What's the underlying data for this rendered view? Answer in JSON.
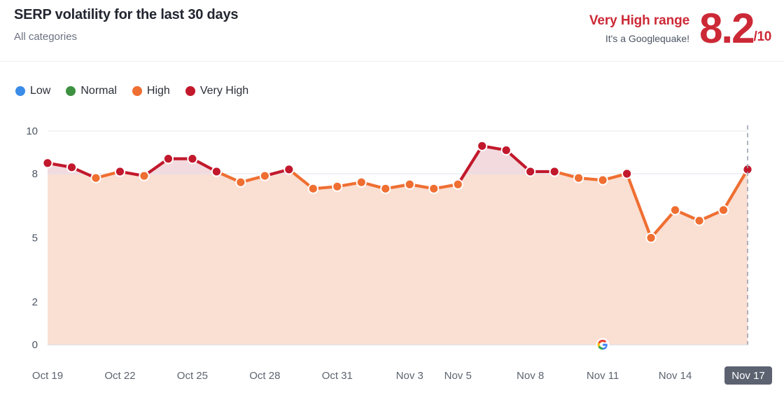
{
  "header": {
    "title": "SERP volatility for the last 30 days",
    "subtitle": "All categories",
    "range_label": "Very High range",
    "range_caption": "It's a Googlequake!",
    "score_value": "8.2",
    "score_denominator": "/10",
    "score_color": "#cc2936"
  },
  "legend": {
    "items": [
      {
        "label": "Low",
        "color": "#3b8ce8"
      },
      {
        "label": "Normal",
        "color": "#3d9140"
      },
      {
        "label": "High",
        "color": "#ef6f32"
      },
      {
        "label": "Very High",
        "color": "#c2182c"
      }
    ]
  },
  "chart_data": {
    "type": "line",
    "title": "SERP volatility for the last 30 days",
    "subtitle": "All categories",
    "xlabel": "",
    "ylabel": "",
    "ylim": [
      0,
      10
    ],
    "y_ticks": [
      "0",
      "2",
      "5",
      "8",
      "10"
    ],
    "y_tick_values": [
      0,
      2,
      5,
      8,
      10
    ],
    "grid": true,
    "legend_position": "top-left",
    "x_tick_labels": [
      "Oct 19",
      "Oct 22",
      "Oct 25",
      "Oct 28",
      "Oct 31",
      "Nov 3",
      "Nov 5",
      "Nov 8",
      "Nov 11",
      "Nov 14",
      "Nov 17"
    ],
    "x_tick_indices": [
      0,
      3,
      6,
      9,
      12,
      15,
      17,
      20,
      23,
      26,
      29
    ],
    "active_x_tick": "Nov 17",
    "x": [
      "Oct 19",
      "Oct 20",
      "Oct 21",
      "Oct 22",
      "Oct 23",
      "Oct 24",
      "Oct 25",
      "Oct 26",
      "Oct 27",
      "Oct 28",
      "Oct 29",
      "Oct 30",
      "Oct 31",
      "Nov 1",
      "Nov 2",
      "Nov 3",
      "Nov 4",
      "Nov 5",
      "Nov 6",
      "Nov 7",
      "Nov 8",
      "Nov 9",
      "Nov 10",
      "Nov 11",
      "Nov 12",
      "Nov 13",
      "Nov 14",
      "Nov 15",
      "Nov 16",
      "Nov 17"
    ],
    "values": [
      8.5,
      8.3,
      7.8,
      8.1,
      7.9,
      8.7,
      8.7,
      8.1,
      7.6,
      7.9,
      8.2,
      7.3,
      7.4,
      7.6,
      7.3,
      7.5,
      7.3,
      7.5,
      9.3,
      9.1,
      8.1,
      8.1,
      7.8,
      7.7,
      8.0,
      5.0,
      6.3,
      5.8,
      6.3,
      8.2
    ],
    "bands": [
      {
        "name": "Low",
        "from": 0,
        "to": 2,
        "color": "#dce7f8"
      },
      {
        "name": "Normal",
        "from": 2,
        "to": 5,
        "color": "#dee9d5"
      },
      {
        "name": "High",
        "from": 5,
        "to": 8,
        "color": "#fadfd3"
      },
      {
        "name": "Very High",
        "from": 8,
        "to": 10,
        "color": "#f2dade"
      }
    ],
    "point_colors": {
      "very_high": "#c2182c",
      "high": "#ef6f32",
      "normal": "#3d9140",
      "low": "#3b8ce8"
    },
    "threshold_very_high": 8,
    "threshold_normal": 5,
    "threshold_low": 2,
    "marker_google": {
      "label": "google-logo",
      "x_index": 23
    },
    "today_marker": {
      "label": "Nov 17",
      "x_index": 29
    }
  }
}
